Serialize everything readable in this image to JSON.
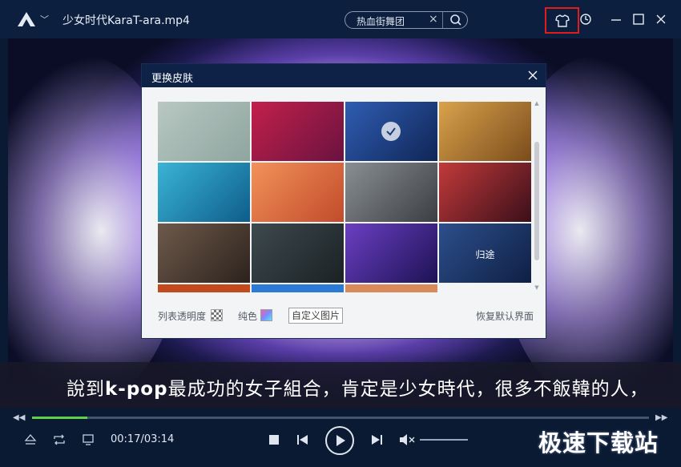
{
  "window": {
    "title": "少女时代KaraT-ara.mp4",
    "search_value": "热血街舞团",
    "icons": [
      "app-logo-icon",
      "chevron-down-icon",
      "search-icon",
      "clear-icon",
      "skin-icon",
      "history-icon",
      "minimize-icon",
      "maximize-icon",
      "close-icon"
    ]
  },
  "subtitle": {
    "prefix": "說到",
    "emphasis": "k-pop",
    "suffix": "最成功的女子組合，肯定是少女時代，很多不飯韓的人，"
  },
  "skin_dialog": {
    "title": "更换皮肤",
    "skins": [
      {
        "row": 0,
        "col": 0,
        "colors": [
          "#b8c7c2",
          "#8fa59f"
        ]
      },
      {
        "row": 0,
        "col": 1,
        "colors": [
          "#c2204a",
          "#6a1240"
        ],
        "selected": false
      },
      {
        "row": 0,
        "col": 2,
        "colors": [
          "#2f5db3",
          "#102657"
        ],
        "selected": true
      },
      {
        "row": 0,
        "col": 3,
        "colors": [
          "#d9a24b",
          "#7a4c1c"
        ]
      },
      {
        "row": 1,
        "col": 0,
        "colors": [
          "#3ab4d6",
          "#0e5d8a"
        ]
      },
      {
        "row": 1,
        "col": 1,
        "colors": [
          "#f2925a",
          "#c24b2a"
        ]
      },
      {
        "row": 1,
        "col": 2,
        "colors": [
          "#8a8f93",
          "#3b3e42"
        ]
      },
      {
        "row": 1,
        "col": 3,
        "colors": [
          "#c23a3a",
          "#3a0f1a"
        ]
      },
      {
        "row": 2,
        "col": 0,
        "colors": [
          "#6e5a4c",
          "#2c221c"
        ]
      },
      {
        "row": 2,
        "col": 1,
        "colors": [
          "#3e4a4e",
          "#1a2124"
        ]
      },
      {
        "row": 2,
        "col": 2,
        "colors": [
          "#6a3fc2",
          "#1d1254"
        ]
      },
      {
        "row": 2,
        "col": 3,
        "colors": [
          "#2c4f8c",
          "#0f1f44"
        ],
        "caption": "归途"
      },
      {
        "row": 3,
        "col": 0,
        "colors": [
          "#c24a1c",
          "#c24a1c"
        ]
      },
      {
        "row": 3,
        "col": 1,
        "colors": [
          "#2a7ad6",
          "#2a7ad6"
        ]
      },
      {
        "row": 3,
        "col": 2,
        "colors": [
          "#d98a5a",
          "#d98a5a"
        ]
      }
    ],
    "transparency_label": "列表透明度",
    "solid_label": "纯色",
    "custom_image_label": "自定义图片",
    "reset_label": "恢复默认界面"
  },
  "player": {
    "progress": 0.089,
    "time_display": "00:17/03:14",
    "accent_color": "#5fd24a",
    "watermark": "极速下载站"
  }
}
